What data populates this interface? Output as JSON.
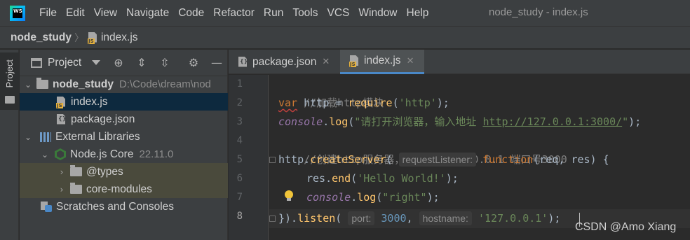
{
  "menubar": {
    "app_logo": "WS",
    "items": [
      "File",
      "Edit",
      "View",
      "Navigate",
      "Code",
      "Refactor",
      "Run",
      "Tools",
      "VCS",
      "Window",
      "Help"
    ],
    "window_title": "node_study - index.js"
  },
  "breadcrumb": {
    "project": "node_study",
    "file": "index.js"
  },
  "toolstrip": {
    "project_tab": "Project"
  },
  "project_panel": {
    "title": "Project",
    "tree": [
      {
        "label": "node_study",
        "hint": "D:\\Code\\dream\\nod"
      },
      {
        "label": "index.js"
      },
      {
        "label": "package.json"
      },
      {
        "label": "External Libraries"
      },
      {
        "label": "Node.js Core",
        "hint": "22.11.0"
      },
      {
        "label": "@types"
      },
      {
        "label": "core-modules"
      },
      {
        "label": "Scratches and Consoles"
      }
    ]
  },
  "editor": {
    "tabs": [
      {
        "label": "package.json"
      },
      {
        "label": "index.js"
      }
    ],
    "line_numbers": [
      "1",
      "2",
      "3",
      "4",
      "5",
      "6",
      "7",
      "8"
    ],
    "code": {
      "l1": "//加载http模块",
      "l2_var": "var",
      "l2_a": " http = ",
      "l2_fn": "require",
      "l2_b": "(",
      "l2_str": "'http'",
      "l2_c": ");",
      "l3_console": "console",
      "l3_a": ".",
      "l3_fn": "log",
      "l3_b": "(",
      "l3_str1": "\"请打开浏览器，输入地址 ",
      "l3_link": "http://127.0.0.1:3000/",
      "l3_str2": "\"",
      "l3_c": ");",
      "l4": "//创建http服务器，监听网址127.0.0.1 端口号3000",
      "l5_a": "http.",
      "l5_fn": "createServer",
      "l5_b": "( ",
      "l5_hint": "requestListener:",
      "l5_kw": " function",
      "l5_c": "(req, res) {",
      "l6_a": "res.",
      "l6_fn": "end",
      "l6_b": "(",
      "l6_str": "'Hello World!'",
      "l6_c": ");",
      "l7_console": "console",
      "l7_a": ".",
      "l7_fn": "log",
      "l7_b": "(",
      "l7_str": "\"right\"",
      "l7_c": ");",
      "l8_a": "}).",
      "l8_fn": "listen",
      "l8_b": "( ",
      "l8_hint1": "port:",
      "l8_num": " 3000",
      "l8_c": ", ",
      "l8_hint2": "hostname:",
      "l8_str": " '127.0.0.1'",
      "l8_d": ");"
    }
  },
  "watermark": "CSDN @Amo Xiang",
  "colors": {
    "background": "#2b2b2b",
    "keyword": "#cc7832",
    "string": "#6a8759",
    "function": "#ffc66d",
    "number": "#6897bb",
    "comment": "#808080",
    "selection": "#0d293e",
    "tab_accent": "#4a88c7"
  }
}
